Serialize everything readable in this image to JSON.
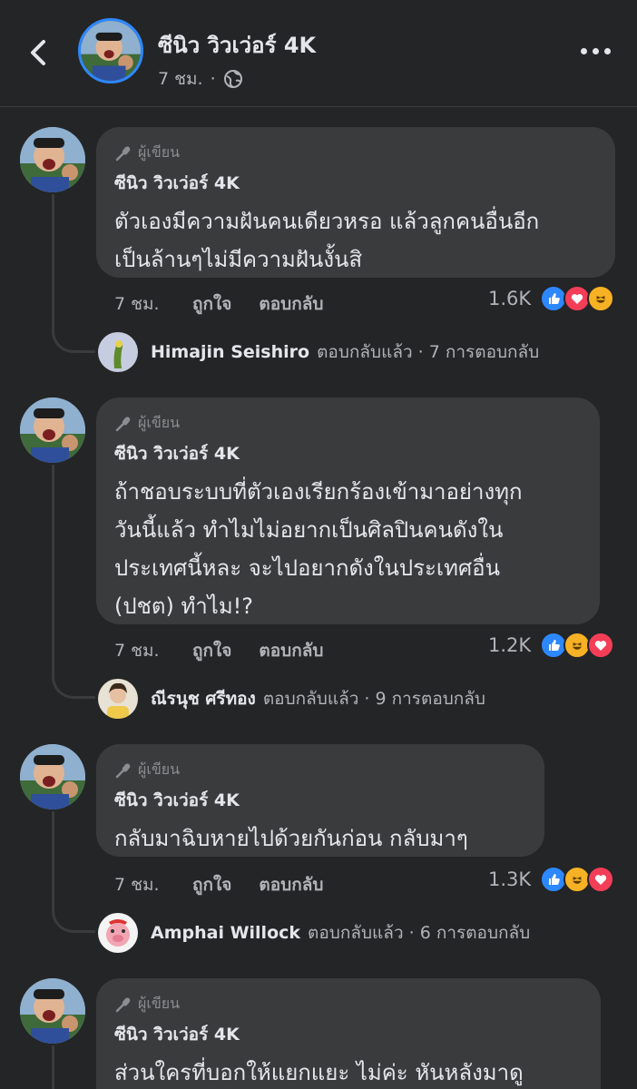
{
  "header": {
    "name": "ซีนิว วิวเว่อร์ 4K",
    "time": "7 ชม.",
    "dot": "·"
  },
  "comments": [
    {
      "author_tag": "ผู้เขียน",
      "name": "ซีนิว วิวเว่อร์ 4K",
      "text_lines": [
        "ตัวเองมีความฝันคนเดียวหรอ แล้วลูกคนอื่นอีก",
        "เป็นล้านๆไม่มีความฝันงั้นสิ"
      ],
      "time": "7 ชม.",
      "like": "ถูกใจ",
      "reply": "ตอบกลับ",
      "reaction_count": "1.6K",
      "reactions": [
        "like",
        "love",
        "haha"
      ],
      "reply_preview": {
        "name": "Himajin Seishiro",
        "action": "ตอบกลับแล้ว",
        "count": "· 7 การตอบกลับ"
      }
    },
    {
      "author_tag": "ผู้เขียน",
      "name": "ซีนิว วิวเว่อร์ 4K",
      "text_lines": [
        "ถ้าชอบระบบที่ตัวเองเรียกร้องเข้ามาอย่างทุก",
        "วันนี้แล้ว ทำไมไม่อยากเป็นศิลปินคนดังใน",
        "ประเทศนี้หละ จะไปอยากดังในประเทศอื่น",
        "(ปชต) ทำไม!?"
      ],
      "time": "7 ชม.",
      "like": "ถูกใจ",
      "reply": "ตอบกลับ",
      "reaction_count": "1.2K",
      "reactions": [
        "like",
        "haha",
        "love"
      ],
      "reply_preview": {
        "name": "ณีรนุช ศรีทอง",
        "action": "ตอบกลับแล้ว",
        "count": "· 9 การตอบกลับ"
      }
    },
    {
      "author_tag": "ผู้เขียน",
      "name": "ซีนิว วิวเว่อร์ 4K",
      "text_lines": [
        "กลับมาฉิบหายไปด้วยกันก่อน กลับมาๆ"
      ],
      "time": "7 ชม.",
      "like": "ถูกใจ",
      "reply": "ตอบกลับ",
      "reaction_count": "1.3K",
      "reactions": [
        "like",
        "haha",
        "love"
      ],
      "reply_preview": {
        "name": "Amphai Willock",
        "action": "ตอบกลับแล้ว",
        "count": "· 6 การตอบกลับ"
      }
    },
    {
      "author_tag": "ผู้เขียน",
      "name": "ซีนิว วิวเว่อร์ 4K",
      "text_lines": [
        "ส่วนใครที่บอกให้แยกแยะ ไม่ค่ะ หันหลังมาดู"
      ]
    }
  ],
  "colors": {
    "background": "#242526",
    "bubble": "#3a3b3c",
    "like": "#2d88ff",
    "love": "#f33e58",
    "haha": "#f7b125"
  }
}
